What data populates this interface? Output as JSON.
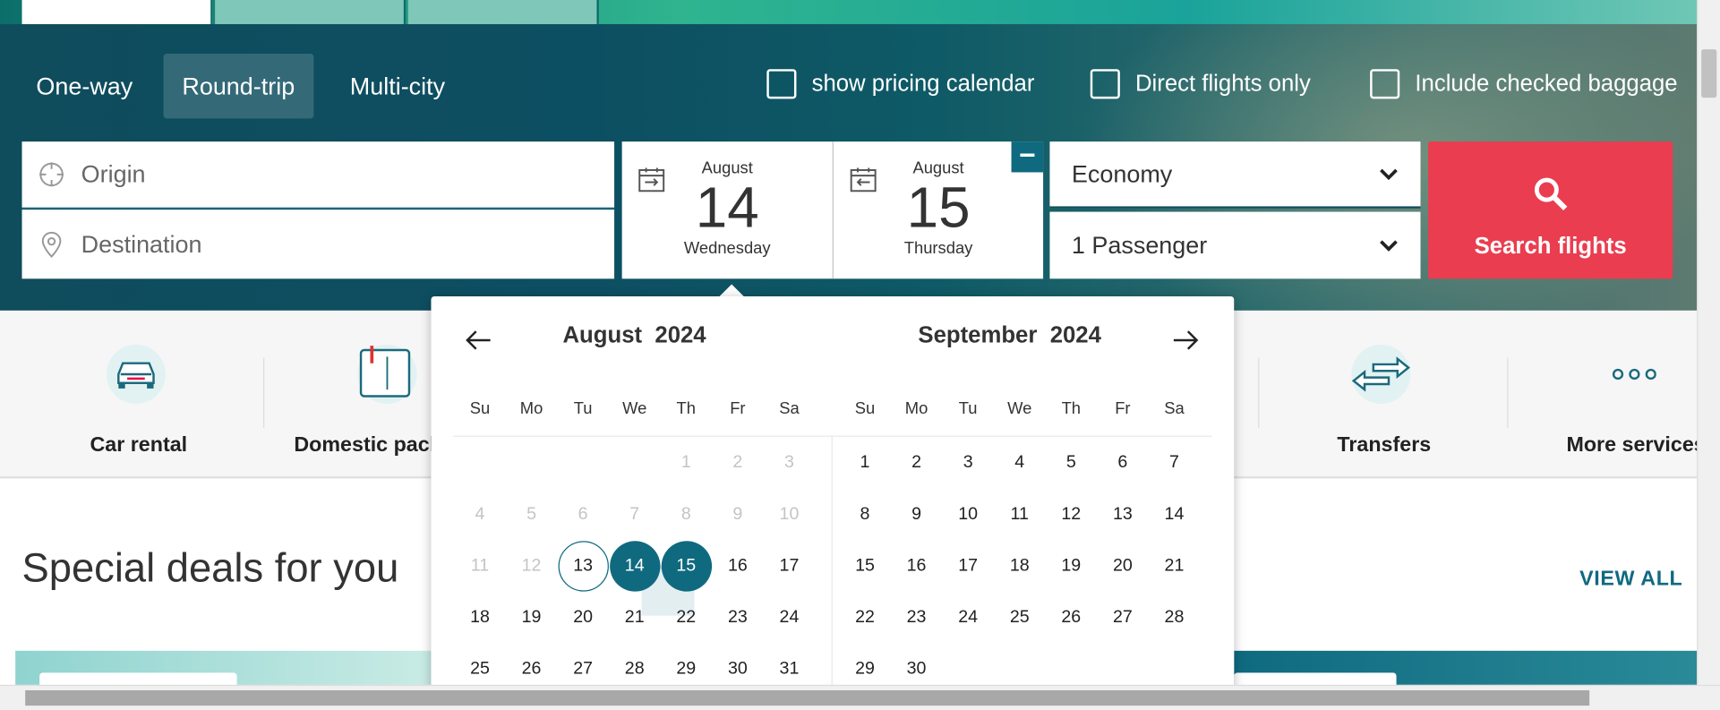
{
  "trip_types": {
    "one_way": "One-way",
    "round_trip": "Round-trip",
    "multi_city": "Multi-city"
  },
  "options": {
    "pricing_calendar": "show pricing calendar",
    "direct_only": "Direct flights only",
    "checked_baggage": "Include checked baggage"
  },
  "search": {
    "origin_placeholder": "Origin",
    "destination_placeholder": "Destination",
    "depart": {
      "month": "August",
      "day": "14",
      "weekday": "Wednesday"
    },
    "return": {
      "month": "August",
      "day": "15",
      "weekday": "Thursday"
    },
    "cabin": "Economy",
    "passengers": "1 Passenger",
    "button": "Search flights"
  },
  "services": {
    "car_rental": "Car rental",
    "domestic_packages": "Domestic packages",
    "transfers": "Transfers",
    "more_services": "More services"
  },
  "deals": {
    "title": "Special deals for you",
    "view_all": "VIEW ALL"
  },
  "calendar": {
    "weekdays": [
      "Su",
      "Mo",
      "Tu",
      "We",
      "Th",
      "Fr",
      "Sa"
    ],
    "left": {
      "month": "August",
      "year": "2024",
      "weeks": [
        [
          "",
          "",
          "",
          "",
          "1",
          "2",
          "3"
        ],
        [
          "4",
          "5",
          "6",
          "7",
          "8",
          "9",
          "10"
        ],
        [
          "11",
          "12",
          "13",
          "14",
          "15",
          "16",
          "17"
        ],
        [
          "18",
          "19",
          "20",
          "21",
          "22",
          "23",
          "24"
        ],
        [
          "25",
          "26",
          "27",
          "28",
          "29",
          "30",
          "31"
        ]
      ],
      "disabled_through": 12,
      "today": 13,
      "selected": [
        14,
        15
      ]
    },
    "right": {
      "month": "September",
      "year": "2024",
      "weeks": [
        [
          "1",
          "2",
          "3",
          "4",
          "5",
          "6",
          "7"
        ],
        [
          "8",
          "9",
          "10",
          "11",
          "12",
          "13",
          "14"
        ],
        [
          "15",
          "16",
          "17",
          "18",
          "19",
          "20",
          "21"
        ],
        [
          "22",
          "23",
          "24",
          "25",
          "26",
          "27",
          "28"
        ],
        [
          "29",
          "30",
          "",
          "",
          "",
          "",
          ""
        ]
      ]
    }
  },
  "colors": {
    "brand": "#0f6a80",
    "search_button": "#ea3d4f"
  }
}
